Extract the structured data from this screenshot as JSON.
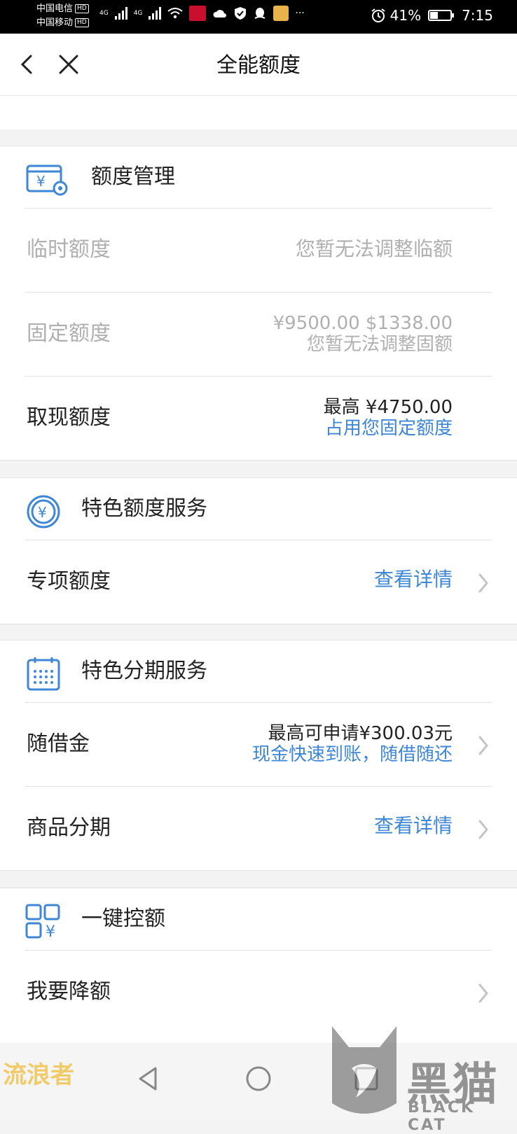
{
  "status_bar": {
    "carrier1": "中国电信",
    "carrier2": "中国移动",
    "hd": "HD",
    "net1": "4G",
    "net2": "4G",
    "more": "···",
    "battery_percent": "41%",
    "battery_level": 0.41,
    "time": "7:15"
  },
  "navbar": {
    "title": "全能额度"
  },
  "sections": {
    "quota_management": {
      "title": "额度管理",
      "temp": {
        "label": "临时额度",
        "value": "您暂无法调整临额"
      },
      "fixed": {
        "label": "固定额度",
        "value": "¥9500.00 $1338.00",
        "note": "您暂无法调整固额"
      },
      "cash": {
        "label": "取现额度",
        "value": "最高 ¥4750.00",
        "note": "占用您固定额度"
      }
    },
    "special_quota": {
      "title": "特色额度服务",
      "special": {
        "label": "专项额度",
        "action": "查看详情"
      }
    },
    "installment": {
      "title": "特色分期服务",
      "borrow": {
        "label": "随借金",
        "value": "最高可申请¥300.03元",
        "note": "现金快速到账，随借随还"
      },
      "goods": {
        "label": "商品分期",
        "action": "查看详情"
      }
    },
    "one_click": {
      "title": "一键控额",
      "reduce": {
        "label": "我要降额"
      }
    }
  },
  "watermarks": {
    "left": "流浪者",
    "right_cn": "黑猫",
    "right_en": "BLACK CAT"
  },
  "colors": {
    "accent_blue": "#3e86d6",
    "disabled_gray": "#b0b0b0",
    "watermark_yellow": "#f1c65a"
  }
}
